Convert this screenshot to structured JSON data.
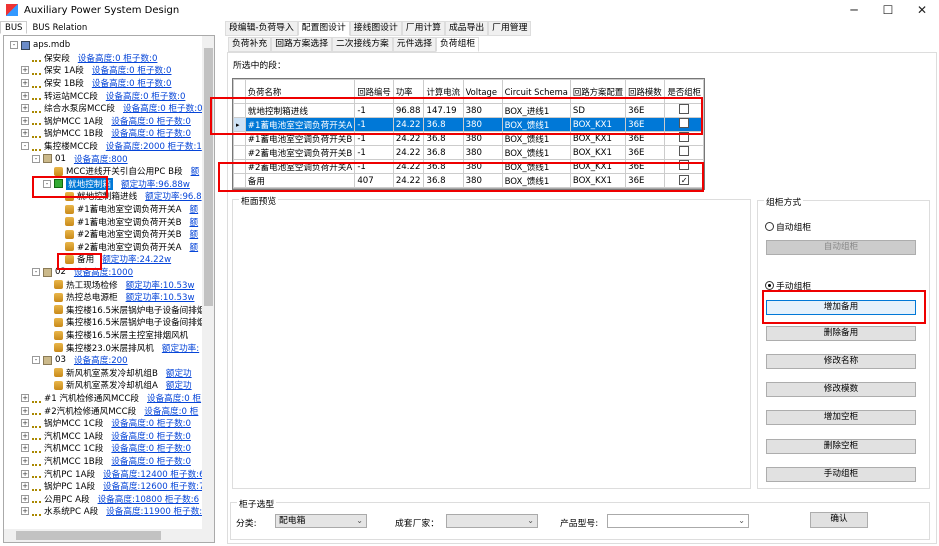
{
  "window": {
    "title": "Auxiliary Power System Design",
    "minimize": "─",
    "maximize": "☐",
    "close": "✕"
  },
  "left_tabs": [
    "BUS",
    "BUS Relation"
  ],
  "tree": [
    {
      "level": 0,
      "exp": "-",
      "icon": "db",
      "text": "aps.mdb"
    },
    {
      "level": 1,
      "exp": "",
      "icon": "net",
      "text": "保安段",
      "link": "设备高度:0  柜子数:0"
    },
    {
      "level": 1,
      "exp": "+",
      "icon": "net",
      "text": "保安 1A段",
      "link": "设备高度:0  柜子数:0"
    },
    {
      "level": 1,
      "exp": "+",
      "icon": "net",
      "text": "保安 1B段",
      "link": "设备高度:0  柜子数:0"
    },
    {
      "level": 1,
      "exp": "+",
      "icon": "net",
      "text": "转运站MCC段",
      "link": "设备高度:0  柜子数:0"
    },
    {
      "level": 1,
      "exp": "+",
      "icon": "net",
      "text": "综合水泵房MCC段",
      "link": "设备高度:0  柜子数:0"
    },
    {
      "level": 1,
      "exp": "+",
      "icon": "net",
      "text": "锅炉MCC 1A段",
      "link": "设备高度:0  柜子数:0"
    },
    {
      "level": 1,
      "exp": "+",
      "icon": "net",
      "text": "锅炉MCC 1B段",
      "link": "设备高度:0  柜子数:0"
    },
    {
      "level": 1,
      "exp": "-",
      "icon": "net",
      "text": "集控楼MCC段",
      "link": "设备高度:2000  柜子数:1"
    },
    {
      "level": 2,
      "exp": "-",
      "icon": "grp",
      "text": "01",
      "link": "设备高度:800"
    },
    {
      "level": 3,
      "exp": "",
      "icon": "cyl",
      "text": "MCC进线开关引自公用PC B段",
      "link": "额"
    },
    {
      "level": 3,
      "exp": "-",
      "icon": "grn",
      "text": "就地控制箱",
      "link": "额定功率:96.88w",
      "selected": true
    },
    {
      "level": 4,
      "exp": "",
      "icon": "cyl",
      "text": "就地控制箱进线",
      "link": "额定功率:96.8"
    },
    {
      "level": 4,
      "exp": "",
      "icon": "cyl",
      "text": "#1蓄电池室空调负荷开关A",
      "link": "额"
    },
    {
      "level": 4,
      "exp": "",
      "icon": "cyl",
      "text": "#1蓄电池室空调负荷开关B",
      "link": "额"
    },
    {
      "level": 4,
      "exp": "",
      "icon": "cyl",
      "text": "#2蓄电池室空调负荷开关B",
      "link": "额"
    },
    {
      "level": 4,
      "exp": "",
      "icon": "cyl",
      "text": "#2蓄电池室空调负荷开关A",
      "link": "额"
    },
    {
      "level": 4,
      "exp": "",
      "icon": "cyl",
      "text": "备用",
      "link": "额定功率:24.22w"
    },
    {
      "level": 2,
      "exp": "-",
      "icon": "grp",
      "text": "02",
      "link": "设备高度:1000"
    },
    {
      "level": 3,
      "exp": "",
      "icon": "cyl",
      "text": "热工现场检修",
      "link": "额定功率:10.53w"
    },
    {
      "level": 3,
      "exp": "",
      "icon": "cyl",
      "text": "热控总电源柜",
      "link": "额定功率:10.53w"
    },
    {
      "level": 3,
      "exp": "",
      "icon": "cyl",
      "text": "集控楼16.5米层锅炉电子设备间排烟"
    },
    {
      "level": 3,
      "exp": "",
      "icon": "cyl",
      "text": "集控楼16.5米层锅炉电子设备间排烟"
    },
    {
      "level": 3,
      "exp": "",
      "icon": "cyl",
      "text": "集控楼16.5米层主控室排烟风机"
    },
    {
      "level": 3,
      "exp": "",
      "icon": "cyl",
      "text": "集控楼23.0米层排风机",
      "link": "额定功率:"
    },
    {
      "level": 2,
      "exp": "-",
      "icon": "grp",
      "text": "03",
      "link": "设备高度:200"
    },
    {
      "level": 3,
      "exp": "",
      "icon": "cyl",
      "text": "新风机室蒸发冷却机组B",
      "link": "额定功"
    },
    {
      "level": 3,
      "exp": "",
      "icon": "cyl",
      "text": "新风机室蒸发冷却机组A",
      "link": "额定功"
    },
    {
      "level": 1,
      "exp": "+",
      "icon": "net",
      "text": "#1 汽机检修通风MCC段",
      "link": "设备高度:0  柜"
    },
    {
      "level": 1,
      "exp": "+",
      "icon": "net",
      "text": "#2汽机检修通风MCC段",
      "link": "设备高度:0  柜"
    },
    {
      "level": 1,
      "exp": "+",
      "icon": "net",
      "text": "锅炉MCC 1C段",
      "link": "设备高度:0  柜子数:0"
    },
    {
      "level": 1,
      "exp": "+",
      "icon": "net",
      "text": "汽机MCC 1A段",
      "link": "设备高度:0  柜子数:0"
    },
    {
      "level": 1,
      "exp": "+",
      "icon": "net",
      "text": "汽机MCC 1C段",
      "link": "设备高度:0  柜子数:0"
    },
    {
      "level": 1,
      "exp": "+",
      "icon": "net",
      "text": "汽机MCC 1B段",
      "link": "设备高度:0  柜子数:0"
    },
    {
      "level": 1,
      "exp": "+",
      "icon": "net",
      "text": "汽机PC 1A段",
      "link": "设备高度:12400  柜子数:6"
    },
    {
      "level": 1,
      "exp": "+",
      "icon": "net",
      "text": "锅炉PC 1A段",
      "link": "设备高度:12600  柜子数:7"
    },
    {
      "level": 1,
      "exp": "+",
      "icon": "net",
      "text": "公用PC A段",
      "link": "设备高度:10800  柜子数:6"
    },
    {
      "level": 1,
      "exp": "+",
      "icon": "net",
      "text": "水系统PC A段",
      "link": "设备高度:11900  柜子数:"
    }
  ],
  "main_tabs": [
    "段编辑-负荷导入",
    "配置图设计",
    "接线图设计",
    "厂用计算",
    "成品导出",
    "厂用管理"
  ],
  "sub_tabs": [
    "负荷补充",
    "回路方案选择",
    "二次接线方案",
    "元件选择",
    "负荷组柜"
  ],
  "selected_segment_label": "所选中的段：",
  "grid": {
    "headers": [
      "负荷名称",
      "回路编号",
      "功率",
      "计算电流",
      "Voltage",
      "Circuit Schema",
      "回路方案配置",
      "回路模数",
      "是否组柜"
    ],
    "rows": [
      [
        "就地控制箱进线",
        "-1",
        "96.88",
        "147.19",
        "380",
        "BOX_进线1",
        "SD",
        "36E",
        false
      ],
      [
        "#1蓄电池室空调负荷开关A",
        "-1",
        "24.22",
        "36.8",
        "380",
        "BOX_馈线1",
        "BOX_KX1",
        "36E",
        false
      ],
      [
        "#1蓄电池室空调负荷开关B",
        "-1",
        "24.22",
        "36.8",
        "380",
        "BOX_馈线1",
        "BOX_KX1",
        "36E",
        false
      ],
      [
        "#2蓄电池室空调负荷开关B",
        "-1",
        "24.22",
        "36.8",
        "380",
        "BOX_馈线1",
        "BOX_KX1",
        "36E",
        false
      ],
      [
        "#2蓄电池室空调负荷开关A",
        "-1",
        "24.22",
        "36.8",
        "380",
        "BOX_馈线1",
        "BOX_KX1",
        "36E",
        false
      ],
      [
        "备用",
        "407",
        "24.22",
        "36.8",
        "380",
        "BOX_馈线1",
        "BOX_KX1",
        "36E",
        true
      ]
    ],
    "selected_row": 1,
    "row_marker": "▸"
  },
  "preview_label": "柜面预览",
  "mode": {
    "title": "组柜方式",
    "auto_radio": "自动组柜",
    "auto_button": "自动组柜",
    "manual_radio": "手动组柜",
    "selected": "manual",
    "buttons": [
      "增加备用",
      "删除备用",
      "修改名称",
      "修改模数",
      "增加空柜",
      "删除空柜",
      "手动组柜"
    ]
  },
  "cabinet": {
    "title": "柜子选型",
    "category_label": "分类:",
    "category_value": "配电箱",
    "maker_label": "成套厂家：",
    "maker_value": "",
    "model_label": "产品型号:",
    "model_value": "",
    "confirm": "确认"
  }
}
